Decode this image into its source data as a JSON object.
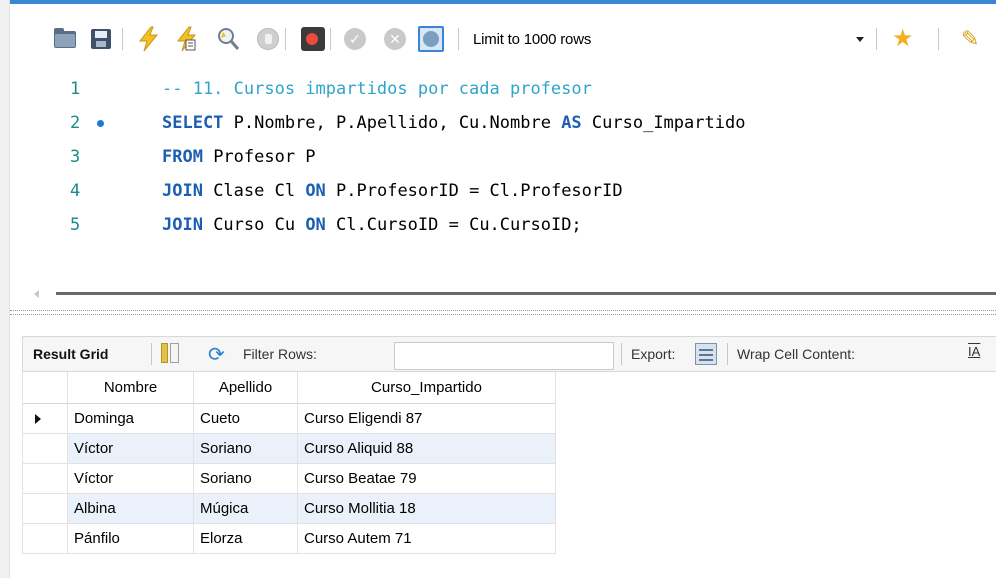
{
  "toolbar": {
    "limit_label": "Limit to 1000 rows",
    "icons": [
      "open-folder-icon",
      "save-icon",
      "execute-icon",
      "execute-current-icon",
      "explain-icon",
      "stop-icon",
      "toggle-error-icon",
      "commit-icon",
      "rollback-icon",
      "autocommit-icon",
      "add-snippet-icon",
      "beautify-icon"
    ]
  },
  "editor": {
    "lines": [
      {
        "num": "1",
        "parts": [
          {
            "t": "-- 11. Cursos impartidos por cada profesor",
            "c": "cm"
          }
        ]
      },
      {
        "num": "2",
        "marker": true,
        "parts": [
          {
            "t": "SELECT",
            "c": "kw"
          },
          {
            "t": " P.Nombre, P.Apellido, Cu.Nombre ",
            "c": ""
          },
          {
            "t": "AS",
            "c": "kw"
          },
          {
            "t": " Curso_Impartido",
            "c": ""
          }
        ]
      },
      {
        "num": "3",
        "parts": [
          {
            "t": "FROM",
            "c": "kw"
          },
          {
            "t": " Profesor P",
            "c": ""
          }
        ]
      },
      {
        "num": "4",
        "parts": [
          {
            "t": "JOIN",
            "c": "kw"
          },
          {
            "t": " Clase Cl ",
            "c": ""
          },
          {
            "t": "ON",
            "c": "kw"
          },
          {
            "t": " P.ProfesorID = Cl.ProfesorID",
            "c": ""
          }
        ]
      },
      {
        "num": "5",
        "parts": [
          {
            "t": "JOIN",
            "c": "kw"
          },
          {
            "t": " Curso Cu ",
            "c": ""
          },
          {
            "t": "ON",
            "c": "kw"
          },
          {
            "t": " Cl.CursoID = Cu.CursoID;",
            "c": ""
          }
        ]
      }
    ]
  },
  "result_toolbar": {
    "result_grid": "Result Grid",
    "filter_rows": "Filter Rows:",
    "filter_value": "",
    "export": "Export:",
    "wrap_cell": "Wrap Cell Content:",
    "wrap_icon": "IA"
  },
  "grid": {
    "columns": [
      "Nombre",
      "Apellido",
      "Curso_Impartido"
    ],
    "rows": [
      [
        "Dominga",
        "Cueto",
        "Curso Eligendi 87"
      ],
      [
        "Víctor",
        "Soriano",
        "Curso Aliquid 88"
      ],
      [
        "Víctor",
        "Soriano",
        "Curso Beatae 79"
      ],
      [
        "Albina",
        "Múgica",
        "Curso Mollitia 18"
      ],
      [
        "Pánfilo",
        "Elorza",
        "Curso Autem 71"
      ]
    ]
  }
}
